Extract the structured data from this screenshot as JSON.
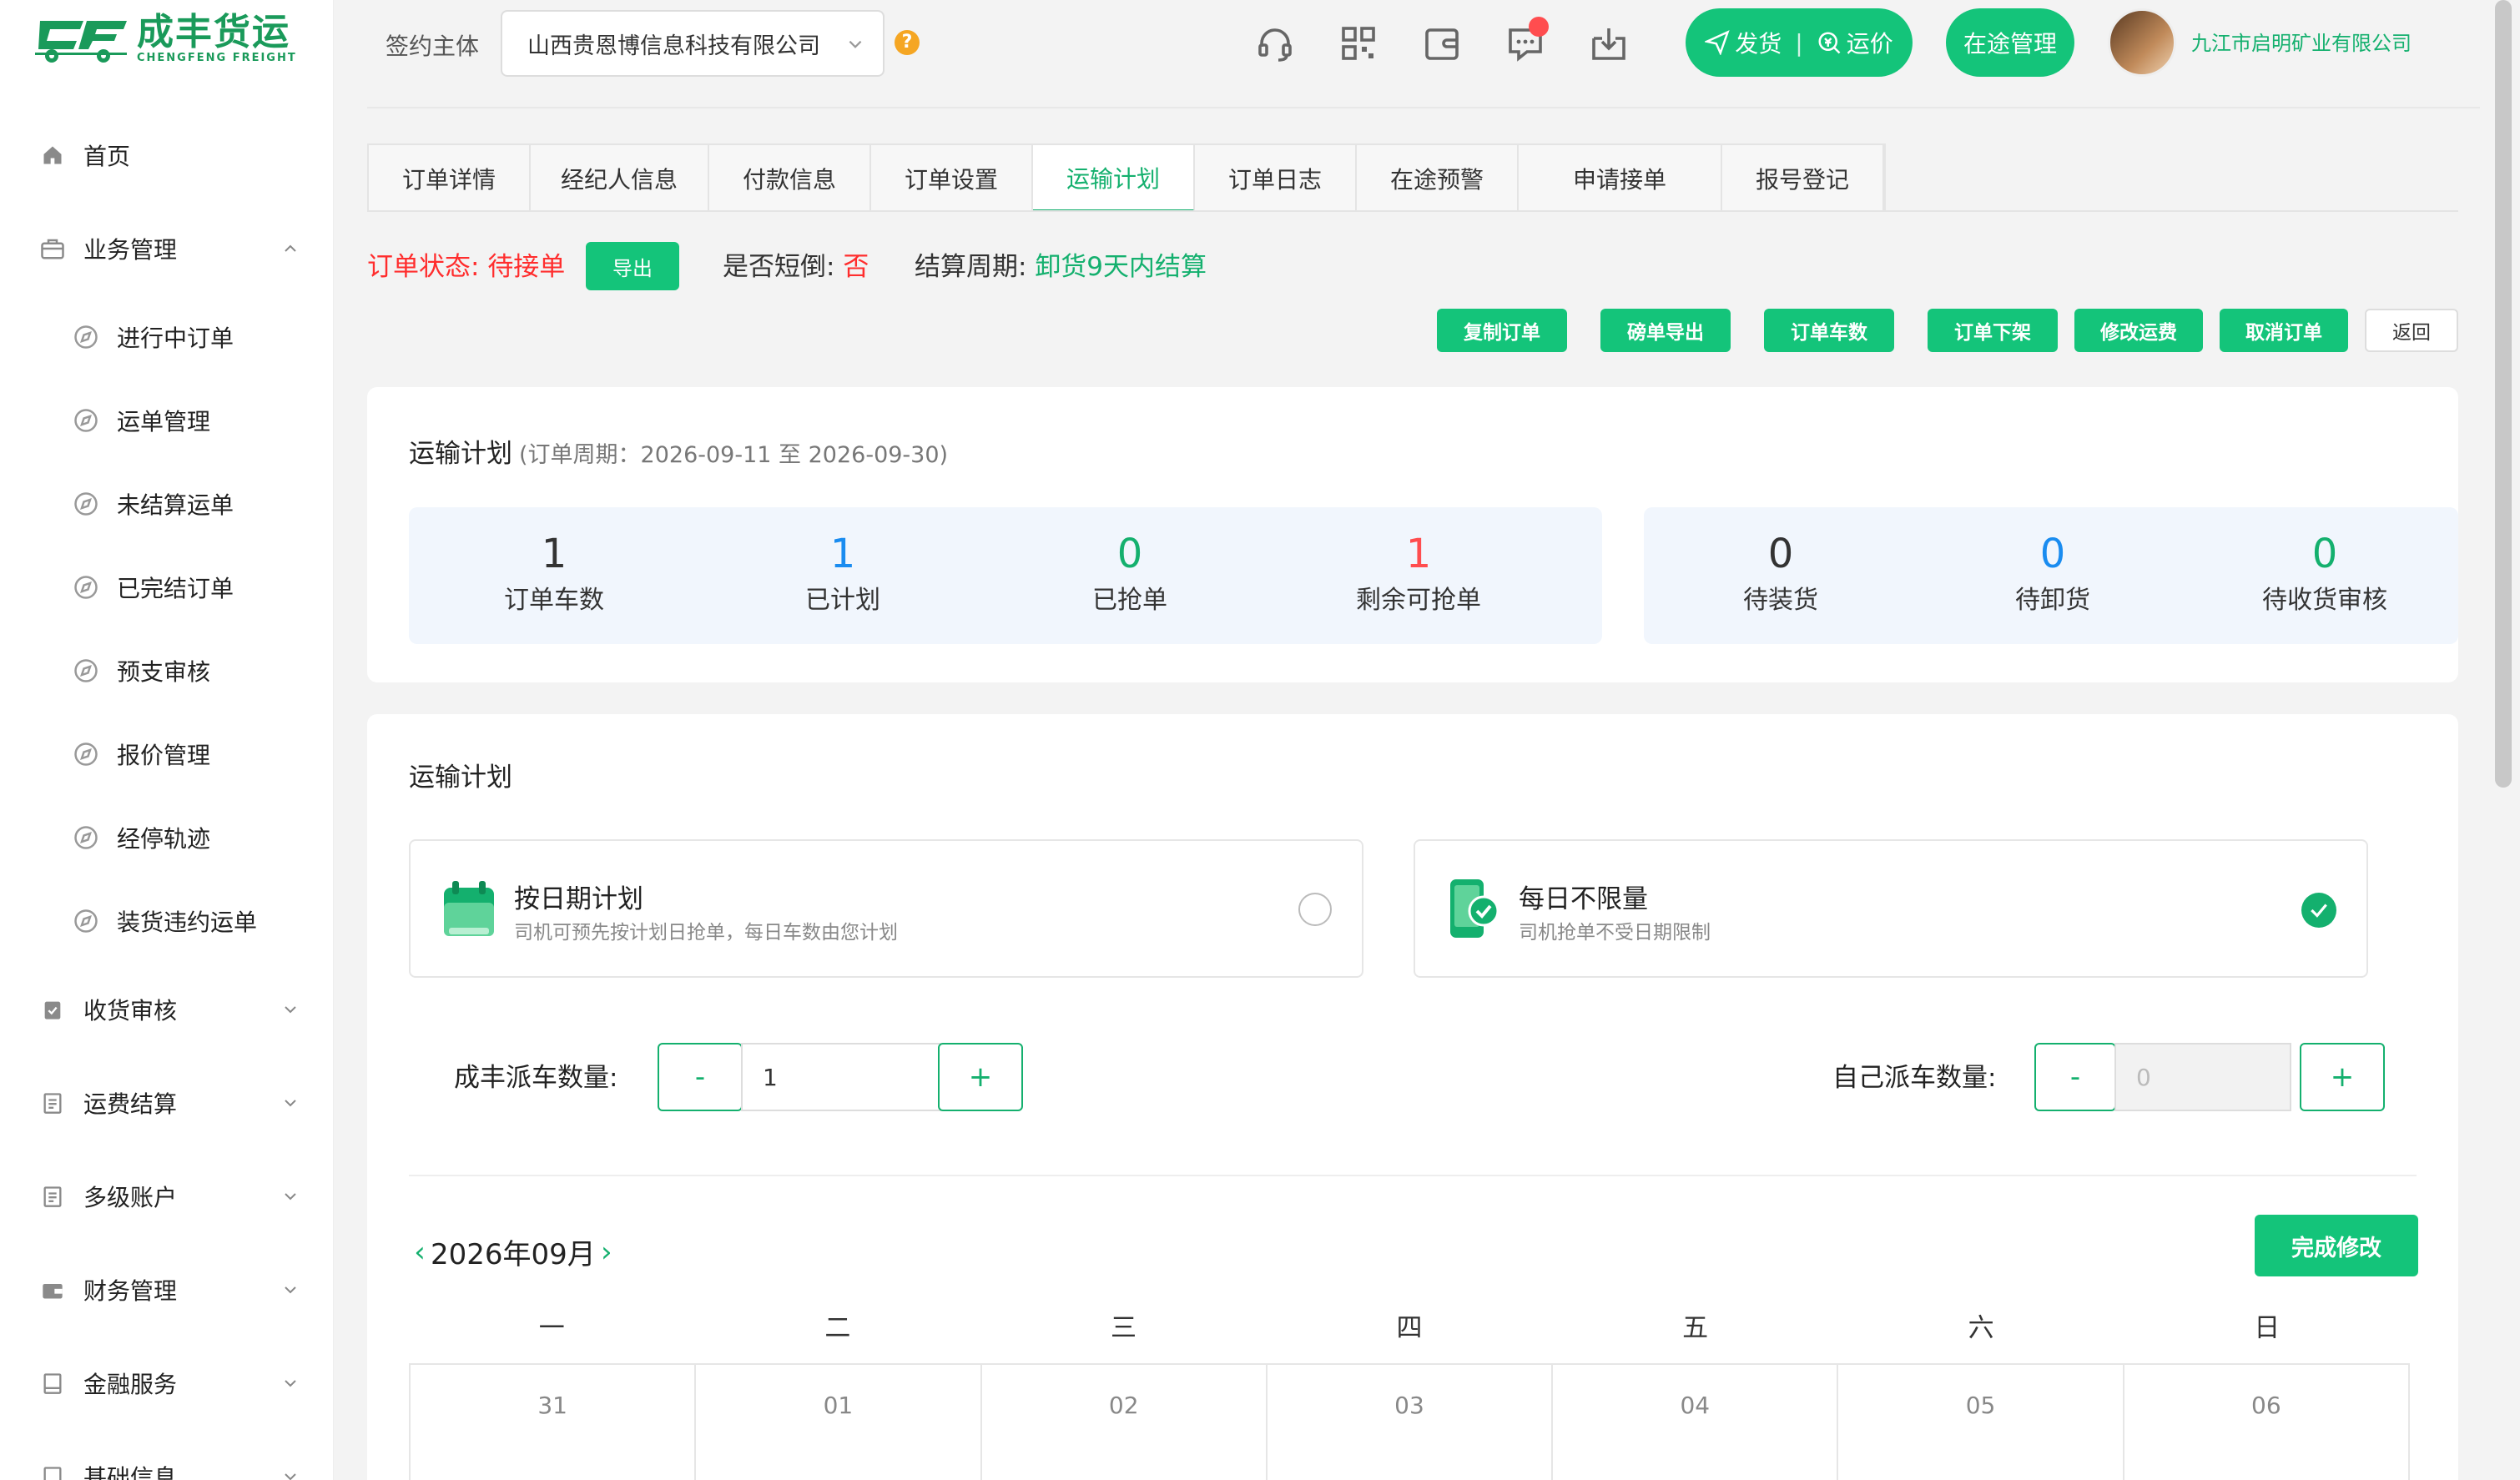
{
  "brand": {
    "name_cn": "成丰货运",
    "name_en": "CHENGFENG FREIGHT"
  },
  "sidebar": {
    "items": [
      {
        "label": "首页",
        "icon": "home-icon"
      },
      {
        "label": "业务管理",
        "icon": "briefcase-icon",
        "expanded": true
      },
      {
        "label": "收货审核",
        "icon": "clipboard-check-icon"
      },
      {
        "label": "运费结算",
        "icon": "document-icon"
      },
      {
        "label": "多级账户",
        "icon": "document-icon"
      },
      {
        "label": "财务管理",
        "icon": "wallet-icon"
      },
      {
        "label": "金融服务",
        "icon": "book-icon"
      },
      {
        "label": "基础信息",
        "icon": "book-icon"
      }
    ],
    "sub_items": [
      "进行中订单",
      "运单管理",
      "未结算运单",
      "已完结订单",
      "预支审核",
      "报价管理",
      "经停轨迹",
      "装货违约运单"
    ]
  },
  "header": {
    "sign_label": "签约主体",
    "sign_value": "山西贵恩博信息科技有限公司",
    "help": "?",
    "ship_label": "发货",
    "price_label": "运价",
    "transit_label": "在途管理",
    "company": "九江市启明矿业有限公司"
  },
  "tabs": [
    "订单详情",
    "经纪人信息",
    "付款信息",
    "订单设置",
    "运输计划",
    "订单日志",
    "在途预警",
    "申请接单",
    "报号登记"
  ],
  "status": {
    "order_status_label": "订单状态: ",
    "order_status_value": "待接单",
    "export_label": "导出",
    "short_label": "是否短倒: ",
    "short_value": "否",
    "period_label": "结算周期: ",
    "period_value": "卸货9天内结算"
  },
  "actions": [
    "复制订单",
    "磅单导出",
    "订单车数",
    "订单下架",
    "修改运费",
    "取消订单",
    "返回"
  ],
  "summary": {
    "title": "运输计划",
    "period": "(订单周期：2026-09-11 至 2026-09-30)",
    "stats_left": [
      {
        "value": "1",
        "label": "订单车数",
        "color": "#222222"
      },
      {
        "value": "1",
        "label": "已计划",
        "color": "#1a8cf0"
      },
      {
        "value": "0",
        "label": "已抢单",
        "color": "#14b06e"
      },
      {
        "value": "1",
        "label": "剩余可抢单",
        "color": "#ff4d4f"
      }
    ],
    "stats_right": [
      {
        "value": "0",
        "label": "待装货",
        "color": "#222222"
      },
      {
        "value": "0",
        "label": "待卸货",
        "color": "#1a8cf0"
      },
      {
        "value": "0",
        "label": "待收货审核",
        "color": "#14b06e"
      }
    ]
  },
  "plan": {
    "title": "运输计划",
    "option_date": {
      "title": "按日期计划",
      "desc": "司机可预先按计划日抢单，每日车数由您计划",
      "selected": false
    },
    "option_unlimited": {
      "title": "每日不限量",
      "desc": "司机抢单不受日期限制",
      "selected": true
    },
    "cf_label": "成丰派车数量:",
    "cf_value": "1",
    "self_label": "自己派车数量:",
    "self_value": "0",
    "minus": "-",
    "plus": "+",
    "month": "2026年09月",
    "prev": "‹",
    "next": "›",
    "done_label": "完成修改",
    "weekdays": [
      "一",
      "二",
      "三",
      "四",
      "五",
      "六",
      "日"
    ],
    "days": [
      "31",
      "01",
      "02",
      "03",
      "04",
      "05",
      "06"
    ]
  }
}
